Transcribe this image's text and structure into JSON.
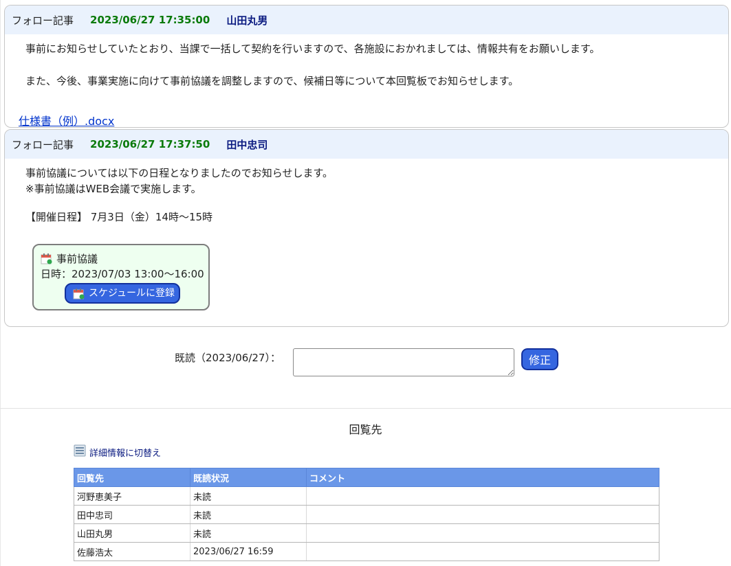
{
  "posts": [
    {
      "type": "フォロー記事",
      "datetime": "2023/06/27 17:35:00",
      "author": "山田丸男",
      "paragraphs": [
        "事前にお知らせしていたとおり、当課で一括して契約を行いますので、各施設におかれましては、情報共有をお願いします。",
        "また、今後、事業実施に向けて事前協議を調整しますので、候補日等について本回覧板でお知らせします。"
      ],
      "attachment": "仕様書（例）.docx"
    },
    {
      "type": "フォロー記事",
      "datetime": "2023/06/27 17:37:50",
      "author": "田中忠司",
      "lines": [
        "事前協議については以下の日程となりましたのでお知らせします。",
        "※事前協議はWEB会議で実施します。"
      ],
      "schedule_line": "【開催日程】 7月3日（金）14時～15時",
      "event": {
        "title": "事前協議",
        "datetime": "日時：2023/07/03 13:00～16:00",
        "register_button": "スケジュールに登録"
      }
    }
  ],
  "read_status": {
    "label": "既読（2023/06/27）：",
    "comment_value": "",
    "edit_button": "修正"
  },
  "recipients": {
    "title": "回覧先",
    "switch_link": "詳細情報に切替え",
    "columns": [
      "回覧先",
      "既読状況",
      "コメント"
    ],
    "rows": [
      [
        "河野恵美子",
        "未読",
        ""
      ],
      [
        "田中忠司",
        "未読",
        ""
      ],
      [
        "山田丸男",
        "未読",
        ""
      ],
      [
        "佐藤浩太",
        "2023/06/27 16:59",
        ""
      ]
    ]
  },
  "colors": {
    "header_bg": "#eaf2fd",
    "date_green": "#0a7a0a",
    "author_navy": "#0a1a80",
    "button_blue": "#3566e0",
    "table_header": "#6a97e8",
    "event_bg": "#eefff0"
  }
}
